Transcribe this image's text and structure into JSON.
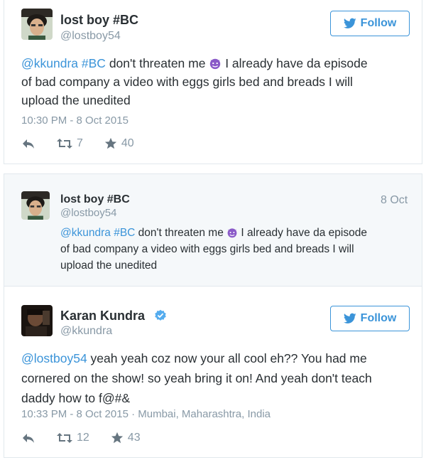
{
  "tweet1": {
    "display_name": "lost boy #BC",
    "screen_name": "@lostboy54",
    "follow_label": "Follow",
    "text_mention1": "@kkundra",
    "text_hashtag": "#BC",
    "text_part1": " don't threaten me ",
    "text_line1_rest": " I already have da episode",
    "text_line2": "of bad company a video with eggs girls bed and breads I will",
    "text_line3": "upload the unedited",
    "timestamp": "10:30 PM - 8 Oct 2015",
    "retweets": "7",
    "likes": "40"
  },
  "quoted": {
    "display_name": "lost boy #BC",
    "screen_name": "@lostboy54",
    "date": "8 Oct",
    "text_mention1": "@kkundra",
    "text_hashtag": "#BC",
    "text_part1": " don't threaten me ",
    "text_line1_rest": " I already have da episode",
    "text_line2": "of bad company a video with eggs girls bed and breads I will",
    "text_line3": "upload the unedited"
  },
  "reply": {
    "display_name": "Karan Kundra",
    "screen_name": "@kkundra",
    "follow_label": "Follow",
    "text_mention": "@lostboy54",
    "text_line1_rest": " yeah yeah coz now your all cool eh?? You had me",
    "text_line2": "cornered on the show! so yeah bring it on! And yeah don't teach",
    "text_line3": "daddy how to f@#&",
    "timestamp": "10:33 PM - 8 Oct 2015 · Mumbai, Maharashtra, India",
    "retweets": "12",
    "likes": "43"
  },
  "colors": {
    "link": "#3b94d9",
    "muted": "#8899a6",
    "text": "#292f33",
    "quoted_bg": "#f5f8fa"
  },
  "icons": [
    "bird-icon",
    "devil-emoji-icon",
    "reply-icon",
    "retweet-icon",
    "star-icon",
    "verified-badge-icon"
  ]
}
